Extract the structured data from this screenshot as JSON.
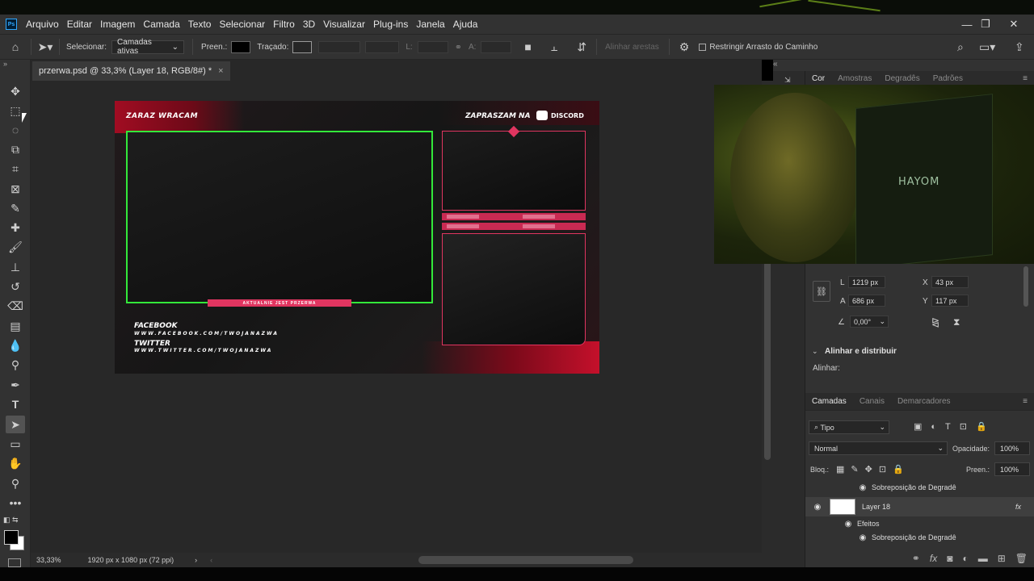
{
  "app": {
    "logo": "Ps"
  },
  "menubar": {
    "items": [
      "Arquivo",
      "Editar",
      "Imagem",
      "Camada",
      "Texto",
      "Selecionar",
      "Filtro",
      "3D",
      "Visualizar",
      "Plug-ins",
      "Janela",
      "Ajuda"
    ]
  },
  "window_controls": {
    "minimize": "—",
    "restore": "❐",
    "close": "✕"
  },
  "options_bar": {
    "select_label": "Selecionar:",
    "select_value": "Camadas ativas",
    "fill_label": "Preen.:",
    "stroke_label": "Traçado:",
    "width_label": "L:",
    "height_label": "A:",
    "align_edges": "Alinhar arestas",
    "constrain_path": "Restringir Arrasto do Caminho"
  },
  "document_tab": {
    "title": "przerwa.psd @ 33,3% (Layer 18, RGB/8#) *",
    "close": "×"
  },
  "artboard": {
    "top_left_text": "ZARAZ WRACAM",
    "top_right_text": "ZAPRASZAM NA",
    "discord_text": "DISCORD",
    "banner_text": "AKTUALNIE JEST PRZERWA",
    "facebook_label": "FACEBOOK",
    "facebook_url": "WWW.FACEBOOK.COM/TWOJANAZWA",
    "twitter_label": "TWITTER",
    "twitter_url": "WWW.TWITTER.COM/TWOJANAZWA",
    "accent_green": "#33e83a",
    "accent_pink": "#e03560"
  },
  "webcam": {
    "brand_text": "HAYOM"
  },
  "right_top_tabs": [
    "Cor",
    "Amostras",
    "Degradês",
    "Padrões"
  ],
  "properties": {
    "l_label": "L",
    "l_value": "1219 px",
    "x_label": "X",
    "x_value": "43 px",
    "a_label": "A",
    "a_value": "686 px",
    "y_label": "Y",
    "y_value": "117 px",
    "angle_value": "0,00°",
    "align_section": "Alinhar e distribuir",
    "align_label": "Alinhar:"
  },
  "layers": {
    "tabs": [
      "Camadas",
      "Canais",
      "Demarcadores"
    ],
    "filter_value": "Tipo",
    "blend_mode": "Normal",
    "opacity_label": "Opacidade:",
    "opacity_value": "100%",
    "lock_label": "Bloq.:",
    "fill_label": "Preen.:",
    "fill_value": "100%",
    "rows": [
      {
        "name": "Sobreposição de Degradê"
      },
      {
        "name": "Layer 18",
        "fx": "fx"
      },
      {
        "name": "Efeitos"
      },
      {
        "name": "Sobreposição de Degradê"
      }
    ]
  },
  "status": {
    "zoom": "33,33%",
    "dimensions": "1920 px x 1080 px (72 ppi)"
  }
}
